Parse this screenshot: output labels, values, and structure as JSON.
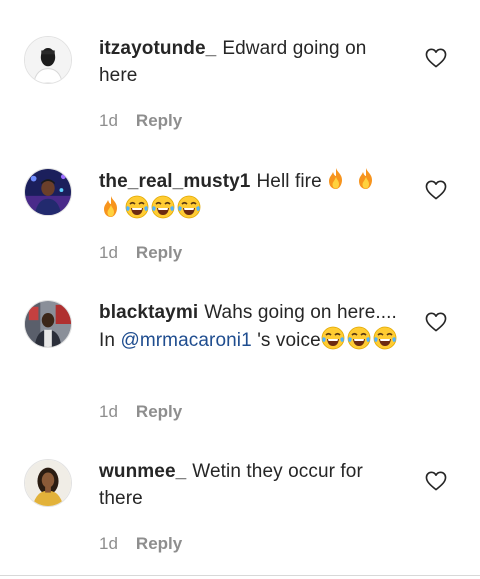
{
  "comments": [
    {
      "username": "itzayotunde_",
      "text": "Edward going on here",
      "time": "1d",
      "reply_label": "Reply"
    },
    {
      "username": "the_real_musty1",
      "text": "Hell fire",
      "emojis": [
        "fire",
        "fire",
        "fire",
        "joy",
        "joy",
        "joy"
      ],
      "time": "1d",
      "reply_label": "Reply"
    },
    {
      "username": "blacktaymi",
      "text_before": "Wahs going on here.... In",
      "mention": "@mrmacaroni1",
      "text_after": "'s voice",
      "emojis": [
        "joy",
        "joy",
        "joy"
      ],
      "time": "1d",
      "reply_label": "Reply"
    },
    {
      "username": "wunmee_",
      "text": "Wetin they occur for there",
      "time": "1d",
      "reply_label": "Reply"
    }
  ],
  "colors": {
    "text": "#262626",
    "meta": "#8e8e8e",
    "mention": "#1f4d8f"
  },
  "icons": {
    "like": "heart-outline-icon",
    "fire": "fire-emoji",
    "joy": "face-with-tears-of-joy-emoji"
  }
}
